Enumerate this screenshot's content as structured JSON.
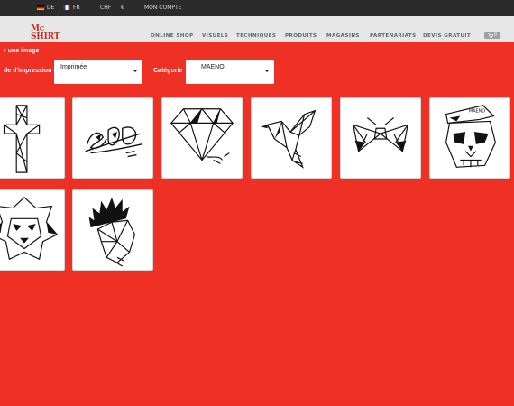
{
  "topbar": {
    "lang_de": "DE",
    "lang_fr": "FR",
    "currency_chf": "CHF",
    "currency_eur": "€",
    "account": "MON COMPTE"
  },
  "logo": {
    "text": "Mc SHIRT"
  },
  "nav": {
    "items": [
      "ONLINE SHOP",
      "VISUELS",
      "TECHNIQUES",
      "PRODUITS",
      "MAGASINS",
      "PARTENARIATS",
      "DEVIS GRATUIT"
    ]
  },
  "cart": {
    "count": "0"
  },
  "panel": {
    "title": "r une image",
    "print_label": "de d'impression",
    "print_value": "Imprimée",
    "category_label": "Catégorie",
    "category_value": "MAENO"
  },
  "gallery": {
    "items": [
      {
        "icon": "cross-drawing-icon"
      },
      {
        "icon": "graffiti-tag-drawing-icon"
      },
      {
        "icon": "diamond-drawing-icon"
      },
      {
        "icon": "bird-drawing-icon"
      },
      {
        "icon": "bow-drawing-icon"
      },
      {
        "icon": "skull-cap-drawing-icon"
      },
      {
        "icon": "lion-drawing-icon"
      },
      {
        "icon": "mohawk-head-drawing-icon"
      }
    ]
  },
  "colors": {
    "accent_red": "#ee3124",
    "logo_red": "#c8302b",
    "topbar_bg": "#2b2b2b",
    "header_bg": "#e7e7e7"
  }
}
